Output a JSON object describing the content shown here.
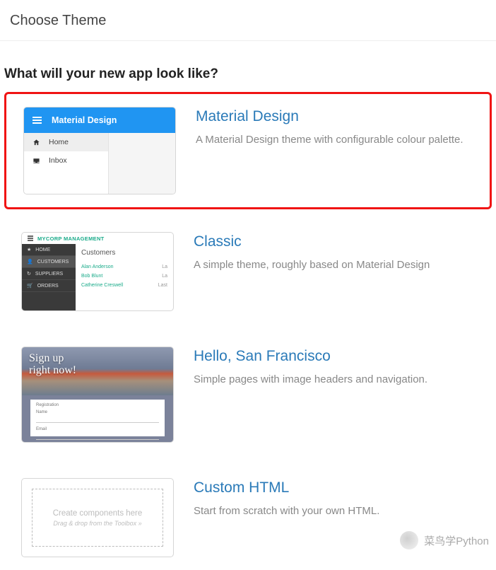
{
  "header": {
    "title": "Choose Theme"
  },
  "question": "What will your new app look like?",
  "themes": [
    {
      "title": "Material Design",
      "desc": "A Material Design theme with configurable colour palette.",
      "selected": true,
      "preview": {
        "appbar_title": "Material Design",
        "nav": [
          {
            "icon": "home-icon",
            "label": "Home",
            "selected": true
          },
          {
            "icon": "inbox-icon",
            "label": "Inbox",
            "selected": false
          }
        ]
      }
    },
    {
      "title": "Classic",
      "desc": "A simple theme, roughly based on Material Design",
      "preview": {
        "brand": "MYCORP MANAGEMENT",
        "nav": [
          {
            "icon": "star-icon",
            "label": "HOME"
          },
          {
            "icon": "user-icon",
            "label": "CUSTOMERS",
            "selected": true
          },
          {
            "icon": "refresh-icon",
            "label": "SUPPLIERS"
          },
          {
            "icon": "cart-icon",
            "label": "ORDERS"
          }
        ],
        "panel_title": "Customers",
        "rows": [
          {
            "name": "Alan Anderson",
            "last": "La"
          },
          {
            "name": "Bob Blunt",
            "last": "La"
          },
          {
            "name": "Catherine Creswell",
            "last": "Last"
          }
        ]
      }
    },
    {
      "title": "Hello, San Francisco",
      "desc": "Simple pages with image headers and navigation.",
      "preview": {
        "hero_line1": "Sign up",
        "hero_line2": "right now!",
        "form_header": "Registration",
        "field1": "Name",
        "field2": "Email"
      }
    },
    {
      "title": "Custom HTML",
      "desc": "Start from scratch with your own HTML.",
      "preview": {
        "placeholder_line1": "Create components here",
        "placeholder_line2": "Drag & drop from the Toolbox »"
      }
    }
  ],
  "watermark": "菜鸟学Python"
}
